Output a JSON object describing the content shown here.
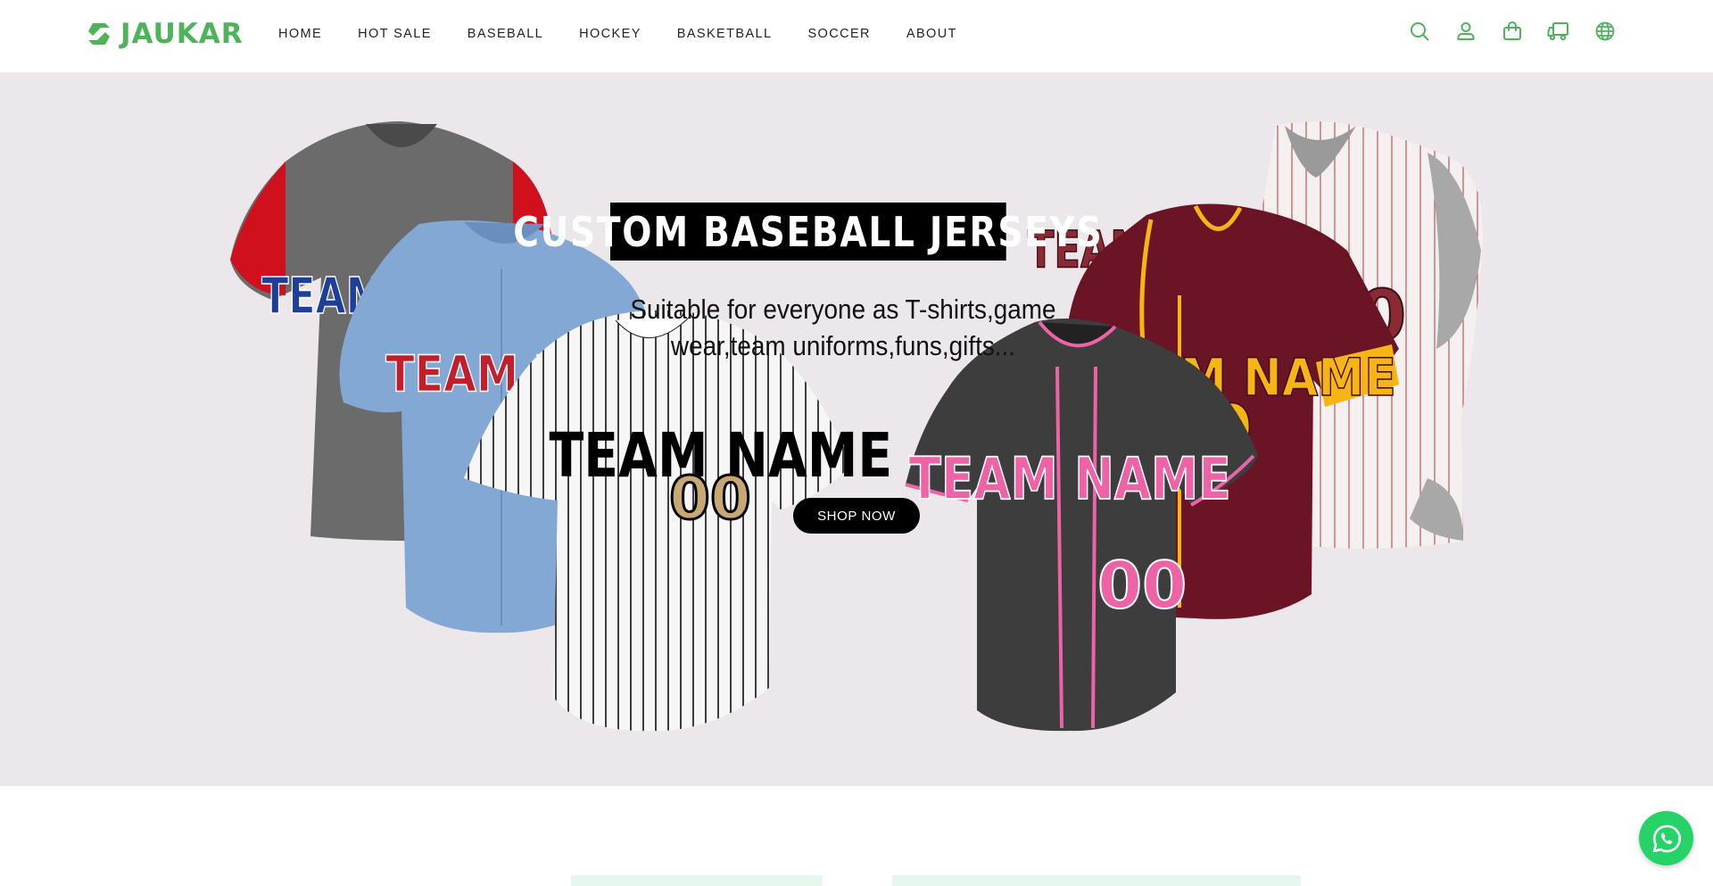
{
  "brand": {
    "name": "JAUKAR",
    "color": "#4fb35a"
  },
  "nav": {
    "items": [
      {
        "label": "HOME"
      },
      {
        "label": "HOT SALE"
      },
      {
        "label": "BASEBALL"
      },
      {
        "label": "HOCKEY"
      },
      {
        "label": "BASKETBALL"
      },
      {
        "label": "SOCCER"
      },
      {
        "label": "ABOUT"
      }
    ]
  },
  "header_icons": [
    "search-icon",
    "account-icon",
    "cart-icon",
    "shipping-truck-icon",
    "language-globe-icon"
  ],
  "hero": {
    "headline": "CUSTOM BASEBALL JERSEYS",
    "subtitle_line1": "Suitable for everyone as T-shirts,game",
    "subtitle_line2": "wear,team uniforms,funs,gifts...",
    "cta_label": "SHOP NOW",
    "background": "#ebe7ea"
  },
  "jerseys": [
    {
      "team_text": "TEAM NAME",
      "body_color": "#6b6b6b",
      "sleeve_color": "#d0101c",
      "letter_color": "#1d3f99"
    },
    {
      "team_text": "TEAM NAME",
      "body_color": "#84a8d4",
      "letter_color": "#c21f2b"
    },
    {
      "team_text": "TEAM NAME",
      "number": "00",
      "body_color": "#f4f4f4",
      "letter_color": "#000000",
      "style": "pinstripe"
    },
    {
      "team_text": "TEAM NAME",
      "number": "00",
      "body_color": "#3d3d3d",
      "letter_color": "#ee63a6"
    },
    {
      "team_text": "TEAM NAME",
      "number": "0",
      "body_color": "#6a1425",
      "letter_color": "#f6b514"
    },
    {
      "team_text": "TEAM NAME",
      "number": "0",
      "body_color": "#f2eeee",
      "letter_color": "#8a2a35",
      "style": "pinstripe"
    }
  ],
  "chat_widget": "whatsapp-icon"
}
